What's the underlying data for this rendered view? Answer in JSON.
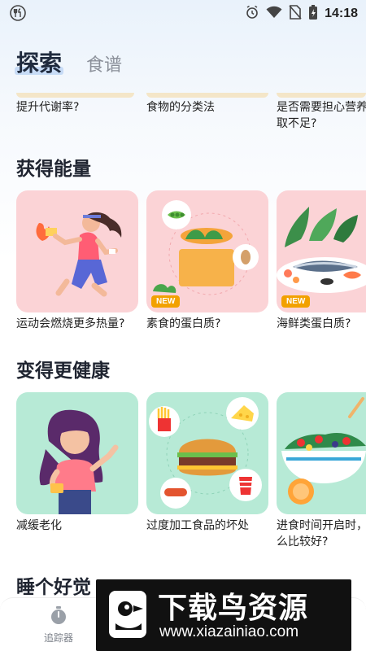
{
  "status_bar": {
    "time": "14:18"
  },
  "header": {
    "tabs": [
      {
        "label": "探索",
        "active": true
      },
      {
        "label": "食谱",
        "active": false
      }
    ]
  },
  "top_row": [
    {
      "label": "提升代谢率?"
    },
    {
      "label": "食物的分类法"
    },
    {
      "label_line1": "是否需要担心营养摄",
      "label_line2": "取不足?"
    }
  ],
  "sections": [
    {
      "title": "获得能量",
      "cards": [
        {
          "label": "运动会燃烧更多热量?",
          "bg": "#fbd0d4",
          "new": false
        },
        {
          "label": "素食的蛋白质?",
          "bg": "#fbd0d4",
          "new": true,
          "badge": "NEW"
        },
        {
          "label": "海鲜类蛋白质?",
          "bg": "#fbd0d4",
          "new": true,
          "badge": "NEW"
        }
      ]
    },
    {
      "title": "变得更健康",
      "cards": [
        {
          "label": "减缓老化",
          "bg": "#b9ead8",
          "new": false
        },
        {
          "label": "过度加工食品的坏处",
          "bg": "#b9ead8",
          "new": false
        },
        {
          "label_line1": "进食时间开启时，吃什",
          "label_line2": "么比较好?",
          "bg": "#b9ead8",
          "new": false
        }
      ]
    },
    {
      "title": "睡个好觉"
    }
  ],
  "bottom_nav": {
    "items": [
      {
        "label": "追踪器",
        "icon": "stopwatch-icon"
      }
    ]
  },
  "watermark": {
    "title": "下载鸟资源",
    "url": "www.xiazainiao.com"
  }
}
